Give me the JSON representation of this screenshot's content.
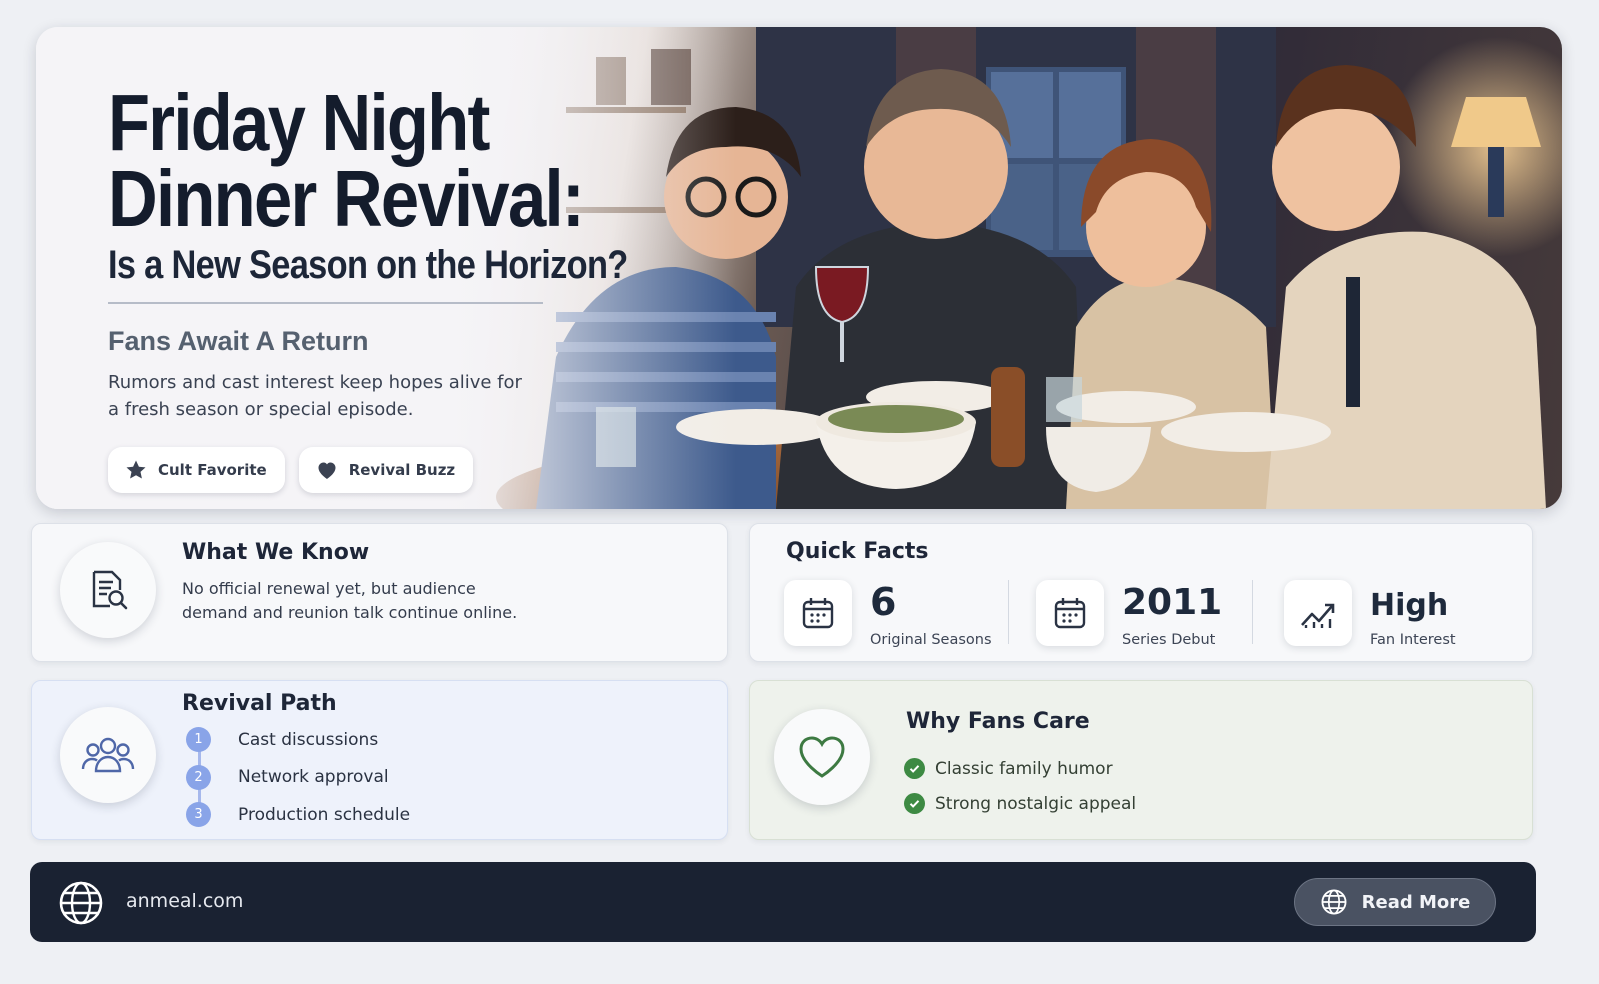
{
  "hero": {
    "title_line1": "Friday Night",
    "title_line2": "Dinner Revival:",
    "subtitle": "Is a New Season on the Horizon?",
    "kicker": "Fans Await A Return",
    "description": "Rumors and cast interest keep hopes alive for a fresh season or special episode.",
    "chips": [
      {
        "label": "Cult Favorite",
        "icon": "star-icon"
      },
      {
        "label": "Revival Buzz",
        "icon": "heart-icon"
      }
    ]
  },
  "what_we_know": {
    "title": "What We Know",
    "body": "No official renewal yet, but audience demand and reunion talk continue online.",
    "icon": "document-search-icon"
  },
  "quick_facts": {
    "title": "Quick Facts",
    "facts": [
      {
        "value": "6",
        "label": "Original Seasons",
        "icon": "calendar-icon"
      },
      {
        "value": "2011",
        "label": "Series Debut",
        "icon": "calendar-icon"
      },
      {
        "value": "High",
        "label": "Fan Interest",
        "icon": "trend-up-icon"
      }
    ]
  },
  "revival_path": {
    "title": "Revival Path",
    "icon": "group-icon",
    "steps": [
      {
        "num": "1",
        "label": "Cast discussions"
      },
      {
        "num": "2",
        "label": "Network approval"
      },
      {
        "num": "3",
        "label": "Production schedule"
      }
    ]
  },
  "why_fans_care": {
    "title": "Why Fans Care",
    "icon": "heart-outline-icon",
    "items": [
      "Classic family humor",
      "Strong nostalgic appeal"
    ]
  },
  "footer": {
    "domain": "anmeal.com",
    "button_label": "Read More",
    "icon": "globe-icon"
  },
  "colors": {
    "accent_blue": "#89a4e8",
    "accent_green": "#3d8a43",
    "footer_bg": "#1a2232"
  }
}
